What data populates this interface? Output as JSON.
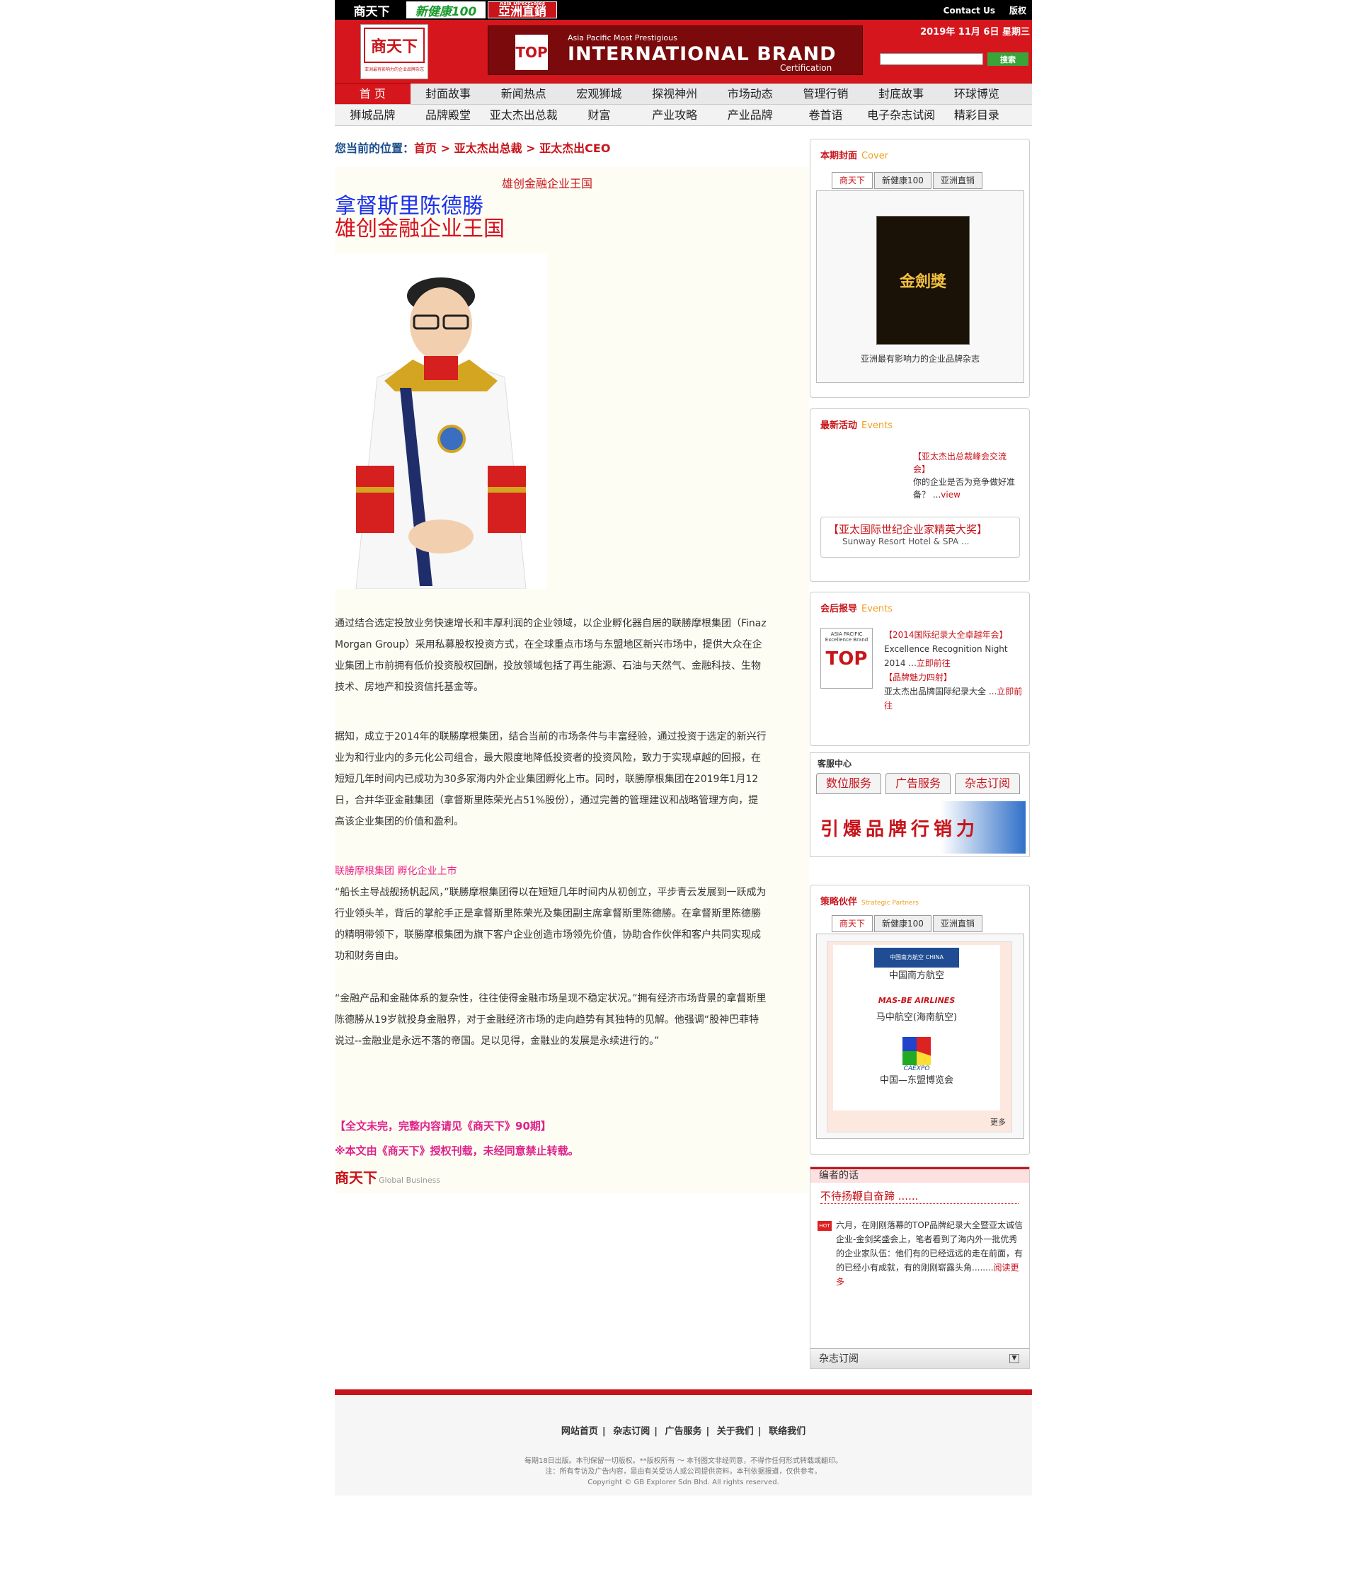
{
  "brands": [
    "商天下",
    "新健康100",
    "亞洲直銷"
  ],
  "brand3_small": "Asia DirectSales",
  "top_links": [
    "Contact Us",
    "版权"
  ],
  "logo": {
    "main": "商天下",
    "en": "Global Business Magazine",
    "slogan": "亚洲最有影响力的企业品牌杂志"
  },
  "banner": {
    "line1": "Asia Pacific Most Prestigious",
    "line2": "INTERNATIONAL BRAND",
    "line3": "Certification",
    "logo": "TOP"
  },
  "date": "2019年 11月 6日 星期三",
  "search": {
    "button": "搜索",
    "placeholder": ""
  },
  "nav1": [
    "首 页",
    "封面故事",
    "新闻热点",
    "宏观狮城",
    "探视神州",
    "市场动态",
    "管理行销",
    "封底故事",
    "环球博览"
  ],
  "nav2": [
    "狮城品牌",
    "品牌殿堂",
    "亚太杰出总裁",
    "财富",
    "产业攻略",
    "产业品牌",
    "卷首语",
    "电子杂志试阅",
    "精彩目录"
  ],
  "breadcrumb": {
    "prefix": "您当前的位置：",
    "items": [
      "首页",
      "亚太杰出总裁",
      "亚太杰出CEO"
    ],
    "sep": " > "
  },
  "article": {
    "subtitle": "雄创金融企业王国",
    "title1": "拿督斯里陈德勝",
    "title2": "雄创金融企业王国",
    "p1": "通过结合选定投放业务快速增长和丰厚利润的企业领域，以企业孵化器自居的联勝摩根集团（Finaz Morgan Group）采用私募股权投资方式，在全球重点市场与东盟地区新兴市场中，提供大众在企业集团上市前拥有低价投资股权回酬，投放领域包括了再生能源、石油与天然气、金融科技、生物技术、房地产和投资信托基金等。",
    "p2": "据知，成立于2014年的联勝摩根集团，结合当前的市场条件与丰富经验，通过投资于选定的新兴行业为和行业内的多元化公司组合，最大限度地降低投资者的投资风险，致力于实现卓越的回报，在短短几年时间内已成功为30多家海内外企业集团孵化上市。同时，联勝摩根集团在2019年1月12日，合并华亚金融集团（拿督斯里陈荣光占51%股份），通过完善的管理建议和战略管理方向，提高该企业集团的价值和盈利。",
    "heading": "联勝摩根集团  孵化企业上市",
    "p3": "“船长主导战舰扬帆起风，”联勝摩根集团得以在短短几年时间内从初创立，平步青云发展到一跃成为行业领头羊，背后的掌舵手正是拿督斯里陈荣光及集团副主席拿督斯里陈德勝。在拿督斯里陈德勝的精明带领下，联勝摩根集团为旗下客户企业创造市场领先价值，协助合作伙伴和客户共同实现成功和财务自由。",
    "p4": "“金融产品和金融体系的复杂性，往往使得金融市场呈现不稳定状况。”拥有经济市场背景的拿督斯里陈德勝从19岁就投身金融界，对于金融经济市场的走向趋势有其独特的见解。他强调“股神巴菲特说过--金融业是永远不落的帝国。足以见得，金融业的发展是永续进行的。”",
    "note1": "【全文未完，完整内容请见《商天下》90期】",
    "note2": "※本文由《商天下》授权刊载，未经同意禁止转载。",
    "sig": "商天下",
    "sig_en": "Global Business"
  },
  "cover": {
    "title": "本期封面",
    "title_en": "Cover",
    "tabs": [
      "商天下",
      "新健康100",
      "亚洲直销"
    ],
    "caption": "亚洲最有影响力的企业品牌杂志",
    "mag_title": "金劍獎"
  },
  "events": {
    "title": "最新活动",
    "title_en": "Events",
    "item_title": "【亚太杰出总裁峰会交流会】",
    "item_text": "你的企业是否为竞争做好准备？ ...",
    "item_link": "view",
    "box_title": "【亚太国际世纪企业家精英大奖】",
    "box_text": "Sunway Resort Hotel & SPA ..."
  },
  "reports": {
    "title": "会后报导",
    "title_en": "Events",
    "logo_top": "ASIA PACIFIC Excellence Brand",
    "r1_title": "【2014国际纪录大全卓越年会】",
    "r1_text": "Excellence Recognition Night 2014 ...",
    "r1_link": "立即前往",
    "r2_title": "【品牌魅力四射】",
    "r2_text": "亚太杰出品牌国际纪录大全 ...",
    "r2_link": "立即前往"
  },
  "service": {
    "title": "客服中心",
    "tabs": [
      "数位服务",
      "广告服务",
      "杂志订阅"
    ],
    "banner": "引爆品牌行销力"
  },
  "partners": {
    "title": "策略伙伴",
    "title_en": "Strategic Partners",
    "tabs": [
      "商天下",
      "新健康100",
      "亚洲直销"
    ],
    "items": [
      "中国南方航空",
      "马中航空(海南航空)",
      "中国—东盟博览会"
    ],
    "logos": [
      "中国南方航空 CHINA SOUTHERN",
      "MAS-BE AIRLINES",
      "CAEXPO"
    ],
    "more": "更多"
  },
  "editor": {
    "title": "编者的话",
    "headline": "不待扬鞭自奋蹄 ......",
    "hot": "HOT",
    "text": "六月，在刚刚落幕的TOP品牌纪录大全暨亚太诚信企业-金剑奖盛会上，笔者看到了海内外一批优秀的企业家队伍：他们有的已经远远的走在前面，有的已经小有成就，有的刚刚崭露头角........",
    "link": "阅读更多",
    "subscribe": "杂志订阅"
  },
  "footer": {
    "links": [
      "网站首页",
      "杂志订阅",
      "广告服务",
      "关于我们",
      "联络我们"
    ],
    "line1": "每期18日出版。本刊保留一切版权。**版权所有 ～ 本刊图文非经同意，不得作任何形式转载或翻印。",
    "line2": "注：所有专访及广告内容，是由有关受访人或公司提供资料。本刊依据报道，仅供参考。",
    "line3": "Copyright © GB Explorer Sdn Bhd. All rights reserved."
  }
}
